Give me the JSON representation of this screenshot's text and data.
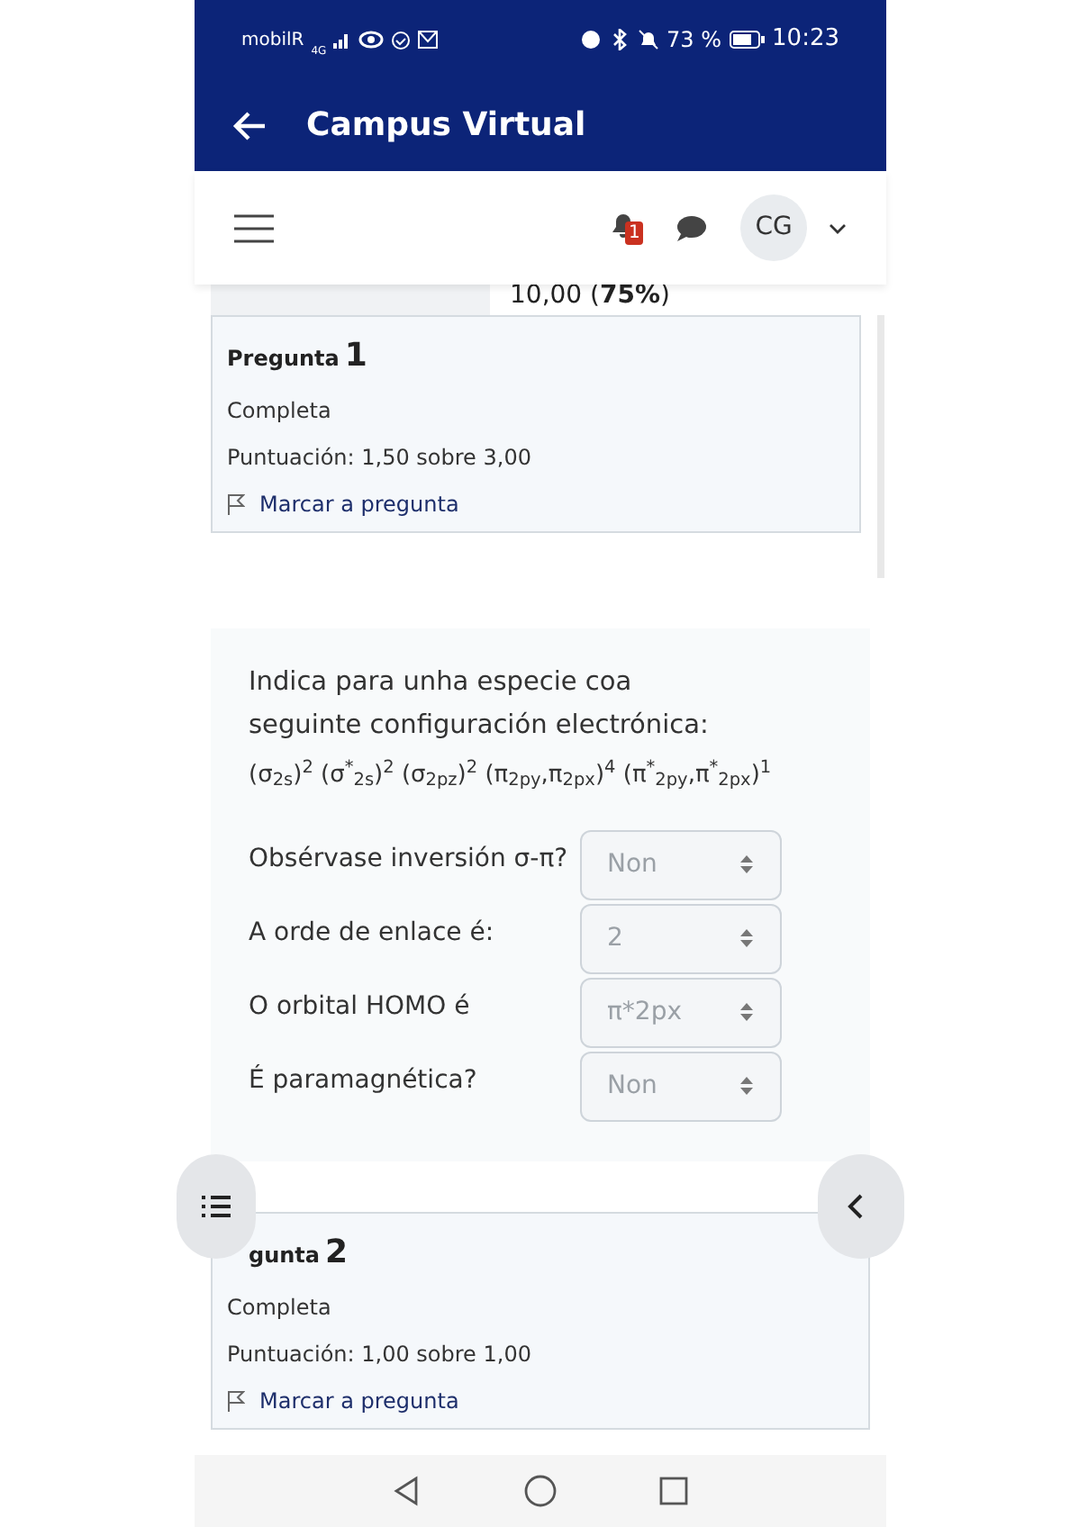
{
  "status_bar": {
    "carrier": "mobilR",
    "network": "4G",
    "battery": "73 %",
    "time": "10:23"
  },
  "app_bar": {
    "title": "Campus Virtual"
  },
  "header": {
    "notification_count": "1",
    "avatar_initials": "CG"
  },
  "grade_row": {
    "value": "10,00 (**75%**)"
  },
  "questions": [
    {
      "label": "Pregunta",
      "number": "1",
      "state": "Completa",
      "score": "Puntuación: 1,50 sobre 3,00",
      "flag_link": "Marcar a pregunta"
    }
  ],
  "question_text": {
    "intro": "Indica para unha especie coa seguinte configuración electrónica:",
    "formula": "(σ$_{2s}$)$^{2}$ (σ$^{*}$$_{2s}$)$^{2}$ (σ$_{2pz}$)$^{2}$ (π$_{2py}$,π$_{2px}$)$^{4}$ (π$^{*}$$_{2py}$,π$^{*}$$_{2px}$)$^{1}$",
    "answers": [
      {
        "label": "Obsérvase inversión σ-π?",
        "value": "Non",
        "disabled": true
      },
      {
        "label": "A orde de enlace é:",
        "value": "2",
        "disabled": true
      },
      {
        "label": "O orbital HOMO é",
        "value": "π*2px",
        "disabled": true
      },
      {
        "label": "É paramagnética?",
        "value": "Non",
        "disabled": true
      }
    ]
  },
  "questions_after": [
    {
      "label": "gunta",
      "number": "2",
      "state": "Completa",
      "score": "Puntuación: 1,00 sobre 1,00",
      "flag_link": "Marcar a pregunta"
    }
  ]
}
